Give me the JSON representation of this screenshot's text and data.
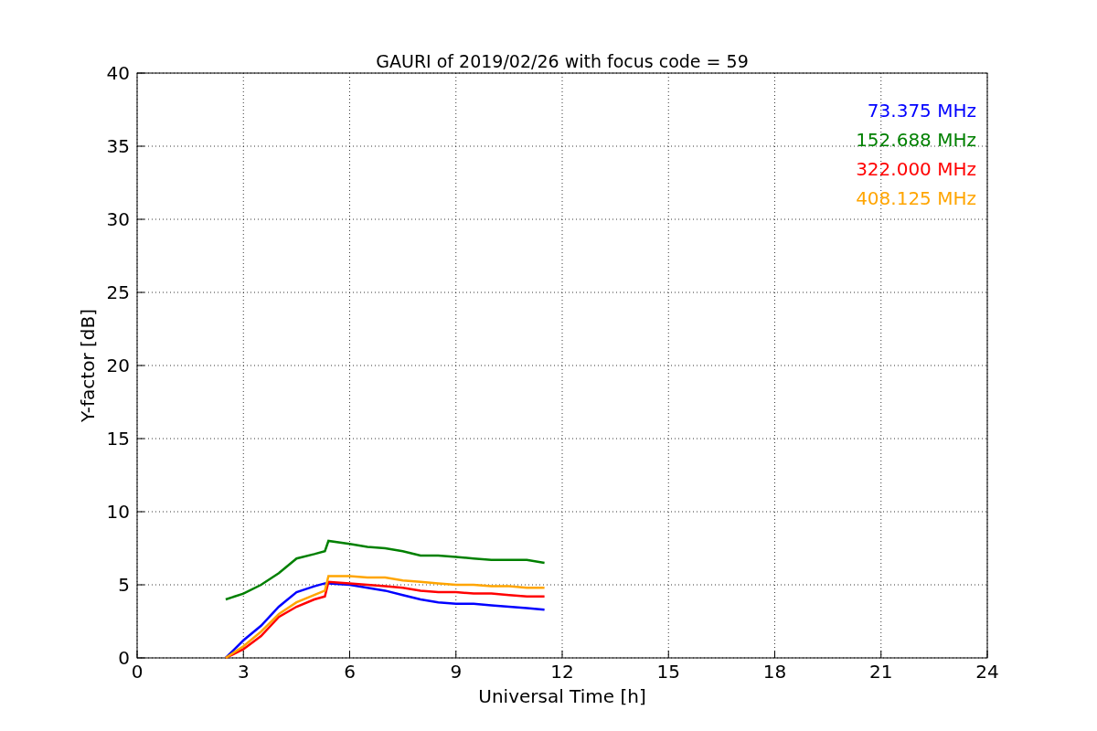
{
  "figure": {
    "chart_data": {
      "type": "line",
      "title": "GAURI of 2019/02/26 with focus code = 59",
      "xlabel": "Universal Time [h]",
      "ylabel": "Y-factor [dB]",
      "x": [
        2.5,
        3,
        3.5,
        4,
        4.5,
        5,
        5.3,
        5.4,
        6,
        6.5,
        7,
        7.5,
        8,
        8.5,
        9,
        9.5,
        10,
        10.5,
        11,
        11.5
      ],
      "series": [
        {
          "name": "73.375 MHz",
          "color": "#0000ff",
          "values": [
            0,
            1.2,
            2.2,
            3.5,
            4.5,
            4.9,
            5.1,
            5.1,
            5.0,
            4.8,
            4.6,
            4.3,
            4.0,
            3.8,
            3.7,
            3.7,
            3.6,
            3.5,
            3.4,
            3.3
          ]
        },
        {
          "name": "152.688 MHz",
          "color": "#008000",
          "values": [
            4.0,
            4.4,
            5.0,
            5.8,
            6.8,
            7.1,
            7.3,
            8.0,
            7.8,
            7.6,
            7.5,
            7.3,
            7.0,
            7.0,
            6.9,
            6.8,
            6.7,
            6.7,
            6.7,
            6.5
          ]
        },
        {
          "name": "322.000 MHz",
          "color": "#ff0000",
          "values": [
            0,
            0.6,
            1.5,
            2.8,
            3.5,
            4.0,
            4.2,
            5.2,
            5.1,
            5.0,
            4.9,
            4.8,
            4.6,
            4.5,
            4.5,
            4.4,
            4.4,
            4.3,
            4.2,
            4.2
          ]
        },
        {
          "name": "408.125 MHz",
          "color": "#ffa500",
          "values": [
            0,
            0.8,
            1.8,
            3.0,
            3.8,
            4.3,
            4.6,
            5.6,
            5.6,
            5.5,
            5.5,
            5.3,
            5.2,
            5.1,
            5.0,
            5.0,
            4.9,
            4.9,
            4.8,
            4.8
          ]
        }
      ],
      "xlim": [
        0,
        24
      ],
      "ylim": [
        0,
        40
      ],
      "xticks": [
        0,
        3,
        6,
        9,
        12,
        15,
        18,
        21,
        24
      ],
      "yticks": [
        0,
        5,
        10,
        15,
        20,
        25,
        30,
        35,
        40
      ],
      "grid": true
    }
  }
}
